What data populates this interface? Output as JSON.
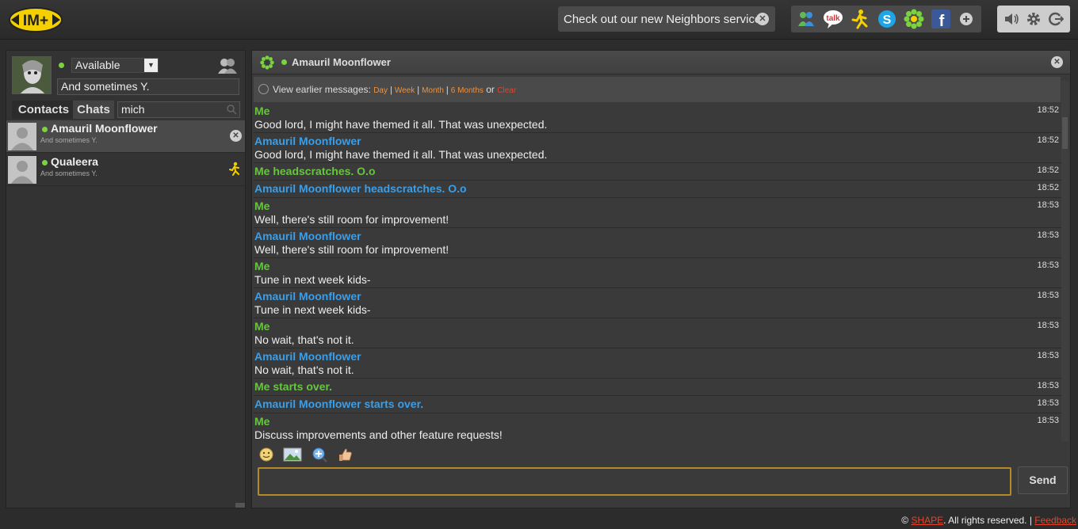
{
  "app": {
    "logo_text": "IM+"
  },
  "promo": {
    "text": "Check out our new Neighbors service!"
  },
  "services": [
    "msn-icon",
    "gtalk-icon",
    "aim-icon",
    "skype-icon",
    "icq-icon",
    "facebook-icon",
    "add-icon"
  ],
  "profile": {
    "status": "Available",
    "status_message": "And sometimes Y."
  },
  "tabs": [
    "Contacts",
    "Chats"
  ],
  "search": {
    "value": "mich"
  },
  "contacts": [
    {
      "name": "Amauril Moonflower",
      "status": "And sometimes Y."
    },
    {
      "name": "Qualeera",
      "status": "And sometimes Y."
    }
  ],
  "chat": {
    "title": "Amauril Moonflower",
    "history": {
      "label": "View earlier messages:",
      "day": "Day",
      "week": "Week",
      "month": "Month",
      "six_months": "6 Months",
      "or": "or",
      "clear": "Clear"
    },
    "messages": [
      {
        "who": "Me",
        "text": "Good lord, I might have themed it all. That was unexpected.",
        "time": "18:52"
      },
      {
        "who": "Amauril Moonflower",
        "text": "Good lord, I might have themed it all. That was unexpected.",
        "time": "18:52"
      },
      {
        "who": "Me headscratches. O.o",
        "text": "",
        "time": "18:52"
      },
      {
        "who": "Amauril Moonflower headscratches. O.o",
        "text": "",
        "time": "18:52"
      },
      {
        "who": "Me",
        "text": "Well, there's still room for improvement!",
        "time": "18:53"
      },
      {
        "who": "Amauril Moonflower",
        "text": "Well, there's still room for improvement!",
        "time": "18:53"
      },
      {
        "who": "Me",
        "text": "Tune in next week kids-",
        "time": "18:53"
      },
      {
        "who": "Amauril Moonflower",
        "text": "Tune in next week kids-",
        "time": "18:53"
      },
      {
        "who": "Me",
        "text": "No wait, that's not it.",
        "time": "18:53"
      },
      {
        "who": "Amauril Moonflower",
        "text": "No wait, that's not it.",
        "time": "18:53"
      },
      {
        "who": "Me starts over.",
        "text": "",
        "time": "18:53"
      },
      {
        "who": "Amauril Moonflower starts over.",
        "text": "",
        "time": "18:53"
      },
      {
        "who": "Me",
        "text": "Discuss improvements and other feature requests!",
        "time": "18:53"
      }
    ],
    "input_value": "",
    "send_label": "Send"
  },
  "footer": {
    "copyright": "©",
    "brand": "SHAPE",
    "rights": ". All rights reserved. |",
    "feedback": "Feedback"
  },
  "colors": {
    "me": "#67c540",
    "them": "#3a9ee8",
    "accent": "#f0913a",
    "link_red": "#e2452b",
    "input_border": "#b58a27"
  }
}
